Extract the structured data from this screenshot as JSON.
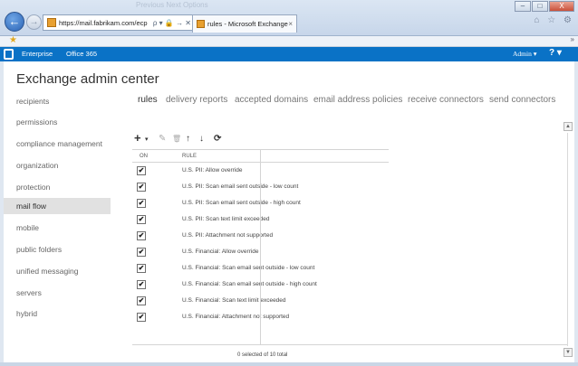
{
  "browser": {
    "ghost_menu": "Previous   Next   Options",
    "back_icon": "back-arrow-icon",
    "url": "https://mail.fabrikam.com/ecp",
    "address_controls": "ρ ▾ 🔒 → ✕",
    "tab_title": "rules - Microsoft Exchange",
    "tab_close": "×",
    "window_buttons": [
      "–",
      "□",
      "X"
    ],
    "chrome_icons": "⌂ ☆ ⚙"
  },
  "favorites": {
    "star": "★",
    "chevron": "»"
  },
  "topbar": {
    "links": [
      "Enterprise",
      "Office 365"
    ],
    "admin": "Admin ▾",
    "help": "? ▾"
  },
  "app": {
    "title": "Exchange admin center"
  },
  "sidebar": {
    "selected_index": 5,
    "items": [
      "recipients",
      "permissions",
      "compliance management",
      "organization",
      "protection",
      "mail flow",
      "mobile",
      "public folders",
      "unified messaging",
      "servers",
      "hybrid"
    ]
  },
  "tabs": [
    "rules",
    "delivery reports",
    "accepted domains",
    "email address policies",
    "receive connectors",
    "send connectors"
  ],
  "toolbar": {
    "add": "+",
    "add_dropdown": "▾",
    "edit": "✎",
    "delete": "🗑",
    "up": "↑",
    "down": "↓",
    "refresh": "⟳"
  },
  "grid": {
    "col_on": "ON",
    "col_rule": "RULE",
    "check_mark": "✔",
    "rows": [
      "U.S. PII: Allow override",
      "U.S. PII: Scan email sent outside - low count",
      "U.S. PII: Scan email sent outside - high count",
      "U.S. PII: Scan text limit exceeded",
      "U.S. PII: Attachment not supported",
      "U.S. Financial: Allow override",
      "U.S. Financial: Scan email sent outside - low count",
      "U.S. Financial: Scan email sent outside - high count",
      "U.S. Financial: Scan text limit exceeded",
      "U.S. Financial: Attachment not supported"
    ],
    "enabled": [
      true,
      true,
      true,
      true,
      true,
      true,
      true,
      true,
      true,
      true
    ]
  },
  "status": "0 selected of 10 total",
  "scroll": {
    "up": "▲",
    "down": "▼"
  }
}
